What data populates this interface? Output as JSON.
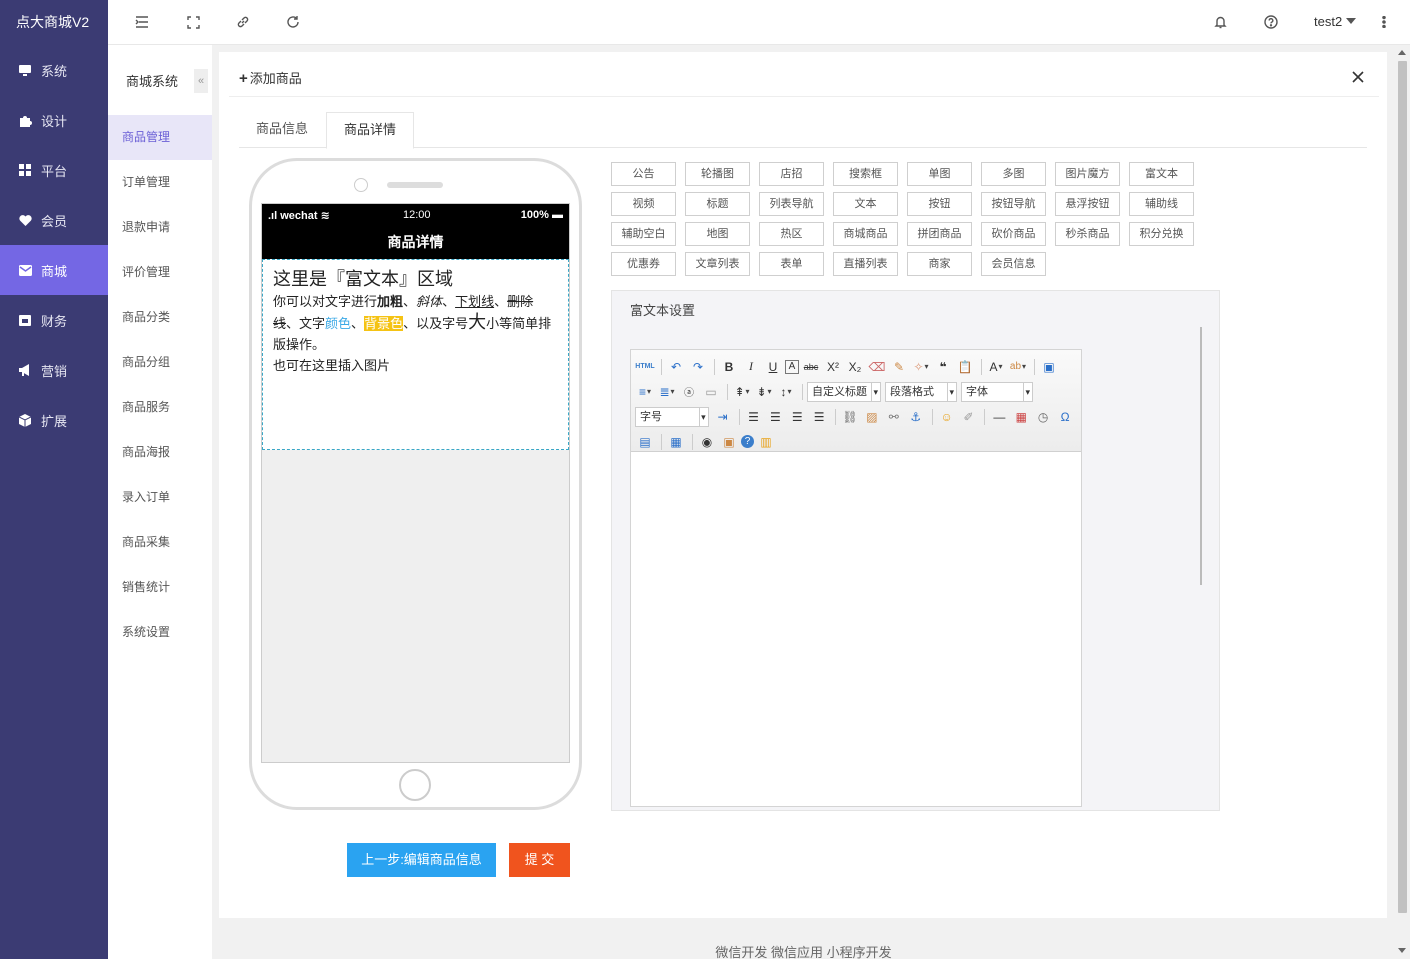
{
  "brand": "点大商城V2",
  "nav": [
    {
      "label": "系统",
      "icon": "monitor-icon"
    },
    {
      "label": "设计",
      "icon": "puzzle-icon"
    },
    {
      "label": "平台",
      "icon": "grid-icon"
    },
    {
      "label": "会员",
      "icon": "heart-icon"
    },
    {
      "label": "商城",
      "icon": "mail-icon"
    },
    {
      "label": "财务",
      "icon": "calendar-icon"
    },
    {
      "label": "营销",
      "icon": "megaphone-icon"
    },
    {
      "label": "扩展",
      "icon": "cube-icon"
    }
  ],
  "nav_active": "商城",
  "sub_title": "商城系统",
  "sub_items": [
    "商品管理",
    "订单管理",
    "退款申请",
    "评价管理",
    "商品分类",
    "商品分组",
    "商品服务",
    "商品海报",
    "录入订单",
    "商品采集",
    "销售统计",
    "系统设置"
  ],
  "user": "test2",
  "card_title": "添加商品",
  "tabs": [
    "商品信息",
    "商品详情"
  ],
  "phone": {
    "carrier": "wechat",
    "time": "12:00",
    "battery": "100%",
    "title": "商品详情",
    "heading": "这里是『富文本』区域",
    "t1": "你可以对文字进行",
    "bold": "加粗",
    "sep1": "、",
    "italic": "斜体",
    "sep2": "、",
    "underline": "下划线",
    "sep3": "、",
    "strike": "删除线",
    "t2": "、文字",
    "color": "颜色",
    "sep4": "、",
    "bgcolor": "背景色",
    "t3": "、以及字号",
    "big": "大",
    "t4": "小等简单排版操作。",
    "line2": "也可在这里插入图片"
  },
  "components": [
    [
      "公告",
      "轮播图",
      "店招",
      "搜索框",
      "单图",
      "多图",
      "图片魔方",
      "富文本"
    ],
    [
      "视频",
      "标题",
      "列表导航",
      "文本",
      "按钮",
      "按钮导航",
      "悬浮按钮",
      "辅助线"
    ],
    [
      "辅助空白",
      "地图",
      "热区",
      "商城商品",
      "拼团商品",
      "砍价商品",
      "秒杀商品",
      "积分兑换"
    ],
    [
      "优惠券",
      "文章列表",
      "表单",
      "直播列表",
      "商家",
      "会员信息"
    ]
  ],
  "rt_panel_title": "富文本设置",
  "editor": {
    "sel_title": "自定义标题",
    "sel_para": "段落格式",
    "sel_font": "字体",
    "sel_size": "字号"
  },
  "btn_prev": "上一步:编辑商品信息",
  "btn_submit": "提 交",
  "footer": "微信开发 微信应用 小程序开发"
}
